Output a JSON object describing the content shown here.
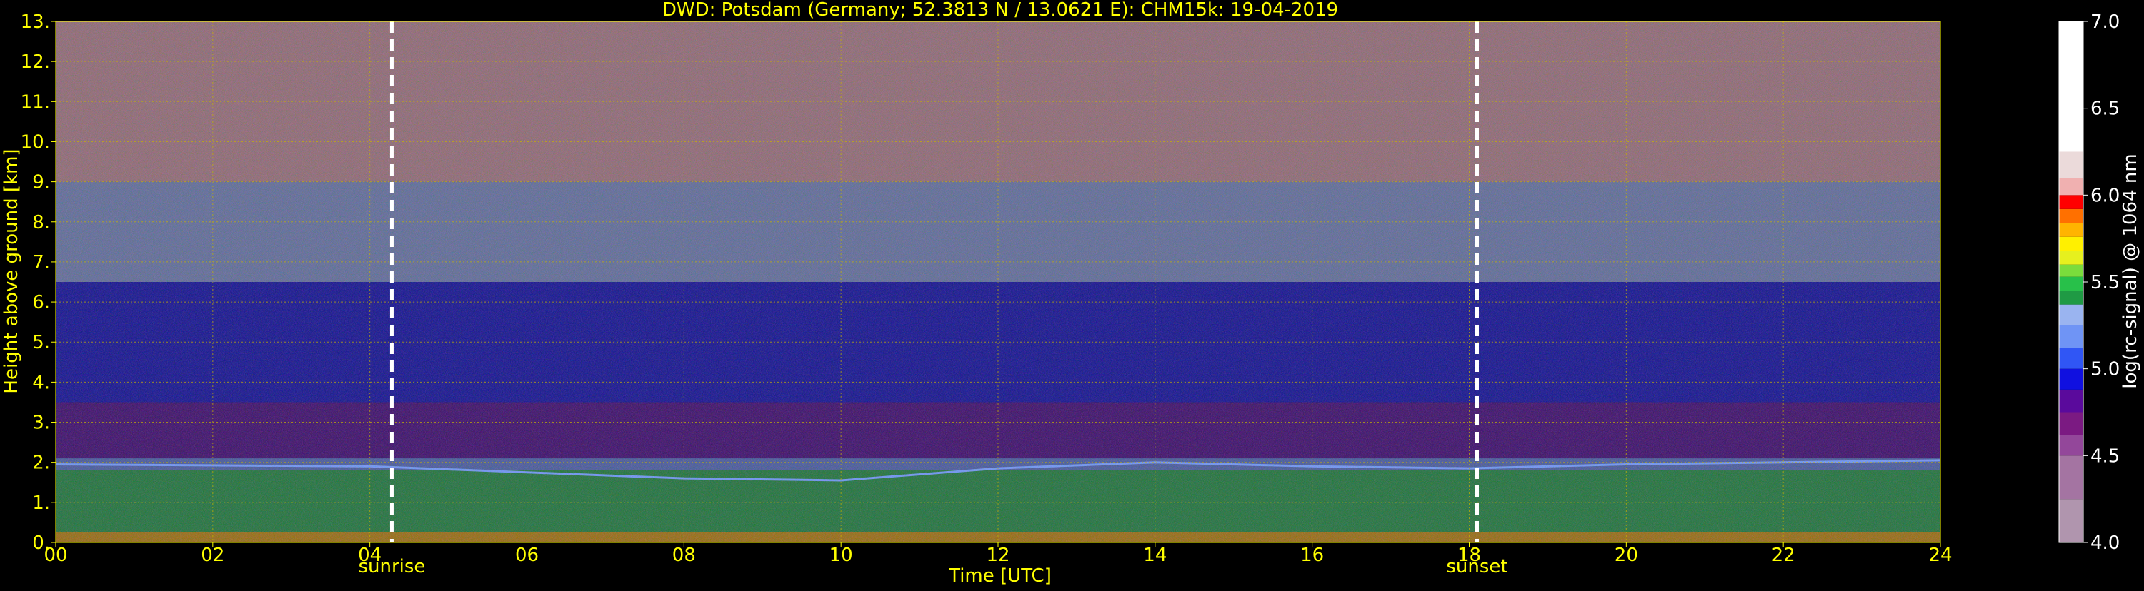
{
  "chart_data": {
    "type": "heatmap",
    "title": "DWD: Potsdam (Germany; 52.3813 N / 13.0621 E):    CHM15k: 19-04-2019",
    "xlabel": "Time [UTC]",
    "ylabel": "Height above ground [km]",
    "xlim": [
      0,
      24
    ],
    "ylim": [
      0,
      13
    ],
    "x_ticks": [
      "00",
      "02",
      "04",
      "06",
      "08",
      "10",
      "12",
      "14",
      "16",
      "18",
      "20",
      "22",
      "24"
    ],
    "y_ticks": [
      "0.",
      "1.",
      "2.",
      "3.",
      "4.",
      "5.",
      "6.",
      "7.",
      "8.",
      "9.",
      "10.",
      "11.",
      "12.",
      "13."
    ],
    "grid": true,
    "colorbar": {
      "label": "log(rc-signal) @ 1064 nm",
      "range": [
        4.0,
        7.0
      ],
      "ticks": [
        "4.0",
        "4.5",
        "5.0",
        "5.5",
        "6.0",
        "6.5",
        "7.0"
      ],
      "levels": [
        {
          "from": 4.0,
          "to": 4.25,
          "color": "#b095ae"
        },
        {
          "from": 4.25,
          "to": 4.5,
          "color": "#a474a2"
        },
        {
          "from": 4.5,
          "to": 4.62,
          "color": "#93479a"
        },
        {
          "from": 4.62,
          "to": 4.75,
          "color": "#7b1a82"
        },
        {
          "from": 4.75,
          "to": 4.88,
          "color": "#5a0a9c"
        },
        {
          "from": 4.88,
          "to": 5.0,
          "color": "#1010e0"
        },
        {
          "from": 5.0,
          "to": 5.12,
          "color": "#3056f5"
        },
        {
          "from": 5.12,
          "to": 5.25,
          "color": "#6f94f5"
        },
        {
          "from": 5.25,
          "to": 5.37,
          "color": "#9ab4f0"
        },
        {
          "from": 5.37,
          "to": 5.45,
          "color": "#1f9a44"
        },
        {
          "from": 5.45,
          "to": 5.53,
          "color": "#28c04a"
        },
        {
          "from": 5.53,
          "to": 5.6,
          "color": "#7bdc3c"
        },
        {
          "from": 5.6,
          "to": 5.68,
          "color": "#e6f01e"
        },
        {
          "from": 5.68,
          "to": 5.76,
          "color": "#fff000"
        },
        {
          "from": 5.76,
          "to": 5.84,
          "color": "#ffb400"
        },
        {
          "from": 5.84,
          "to": 5.92,
          "color": "#ff7000"
        },
        {
          "from": 5.92,
          "to": 6.0,
          "color": "#ff0000"
        },
        {
          "from": 6.0,
          "to": 6.1,
          "color": "#f0b0b0"
        },
        {
          "from": 6.1,
          "to": 6.25,
          "color": "#ebdada"
        },
        {
          "from": 6.25,
          "to": 7.0,
          "color": "#ffffff"
        }
      ]
    },
    "markers": [
      {
        "label": "sunrise",
        "x": 4.28
      },
      {
        "label": "sunset",
        "x": 18.1
      }
    ],
    "signal_layers": [
      {
        "from_km": 0.0,
        "to_km": 0.25,
        "level": 5.8
      },
      {
        "from_km": 0.25,
        "to_km": 1.8,
        "level": 5.45
      },
      {
        "from_km": 1.8,
        "to_km": 2.1,
        "level": 5.2
      },
      {
        "from_km": 2.1,
        "to_km": 3.5,
        "level": 4.75
      },
      {
        "from_km": 3.5,
        "to_km": 6.5,
        "level": 4.95
      },
      {
        "from_km": 6.5,
        "to_km": 9.0,
        "level": 5.3
      },
      {
        "from_km": 9.0,
        "to_km": 13.0,
        "level": 6.0
      }
    ],
    "boundary_layer_top_km": [
      {
        "t": 0,
        "h": 1.95
      },
      {
        "t": 4,
        "h": 1.9
      },
      {
        "t": 8,
        "h": 1.6
      },
      {
        "t": 10,
        "h": 1.55
      },
      {
        "t": 12,
        "h": 1.85
      },
      {
        "t": 14,
        "h": 2.0
      },
      {
        "t": 16,
        "h": 1.9
      },
      {
        "t": 18,
        "h": 1.85
      },
      {
        "t": 20,
        "h": 1.95
      },
      {
        "t": 22,
        "h": 2.0
      },
      {
        "t": 24,
        "h": 2.05
      }
    ],
    "colors": {
      "axis_text": "#ffff00",
      "colorbar_text": "#ffffff",
      "grid": "#c8b400",
      "marker_line": "#ffffff"
    }
  }
}
